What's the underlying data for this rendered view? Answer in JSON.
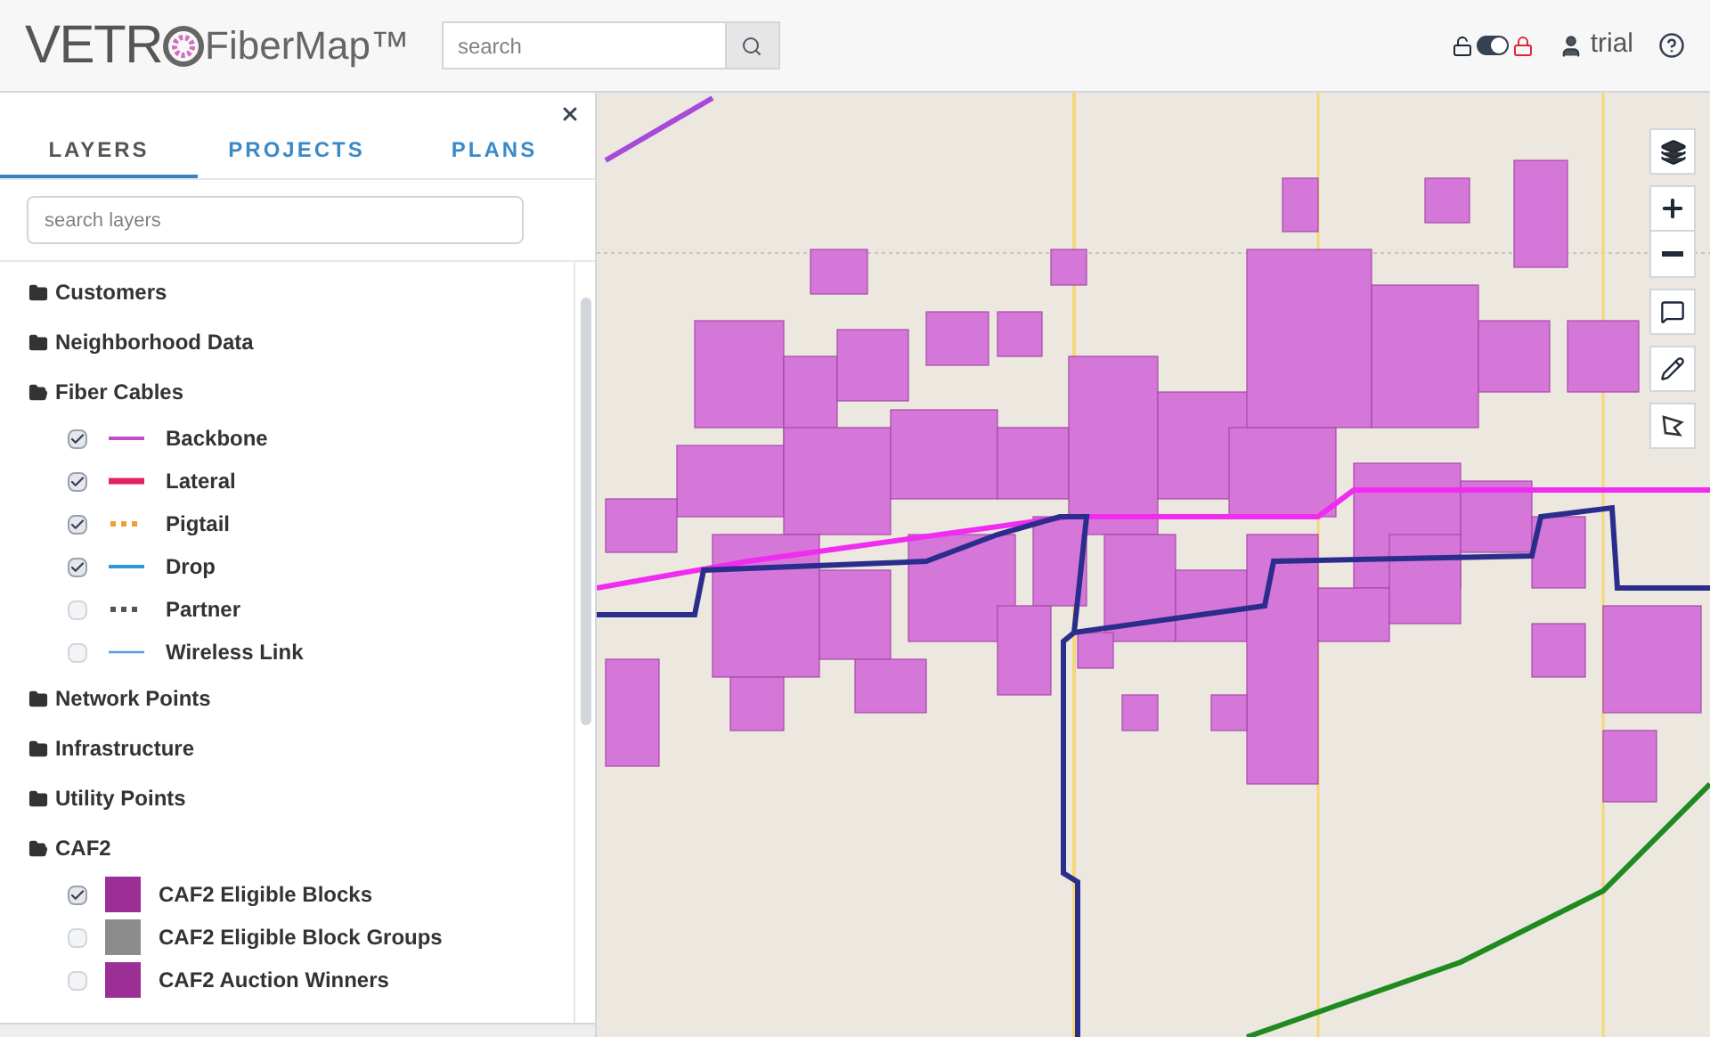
{
  "header": {
    "logo_left": "VETR",
    "logo_right": "FiberMap™",
    "search": {
      "placeholder": "search"
    },
    "lock_toggle": {
      "on": true
    },
    "user": "trial"
  },
  "panel": {
    "tabs": [
      {
        "label": "LAYERS",
        "selected": true
      },
      {
        "label": "PROJECTS",
        "selected": false
      },
      {
        "label": "PLANS",
        "selected": false
      }
    ],
    "search": {
      "placeholder": "search layers"
    },
    "layers": [
      {
        "label": "Customers",
        "expanded": false
      },
      {
        "label": "Neighborhood Data",
        "expanded": false
      },
      {
        "label": "Fiber Cables",
        "expanded": true,
        "children": [
          {
            "label": "Backbone",
            "kind": "line",
            "color": "#c04ec8",
            "checked": true
          },
          {
            "label": "Lateral",
            "kind": "thick",
            "color": "#e0245e",
            "checked": true
          },
          {
            "label": "Pigtail",
            "kind": "dotted",
            "color": "#f0a030",
            "checked": true
          },
          {
            "label": "Drop",
            "kind": "line",
            "color": "#2a9bd8",
            "checked": true
          },
          {
            "label": "Partner",
            "kind": "dotted",
            "color": "#555555",
            "checked": false
          },
          {
            "label": "Wireless Link",
            "kind": "thin",
            "color": "#5b9bd5",
            "checked": false
          }
        ]
      },
      {
        "label": "Network Points",
        "expanded": false
      },
      {
        "label": "Infrastructure",
        "expanded": false
      },
      {
        "label": "Utility Points",
        "expanded": false
      },
      {
        "label": "CAF2",
        "expanded": true,
        "children": [
          {
            "label": "CAF2 Eligible Blocks",
            "kind": "swatch",
            "color": "#9b2f96",
            "checked": true
          },
          {
            "label": "CAF2 Eligible Block Groups",
            "kind": "swatch",
            "color": "#8c8c8c",
            "checked": false
          },
          {
            "label": "CAF2 Auction Winners",
            "kind": "swatch",
            "color": "#9b2f96",
            "checked": false
          }
        ]
      }
    ]
  }
}
